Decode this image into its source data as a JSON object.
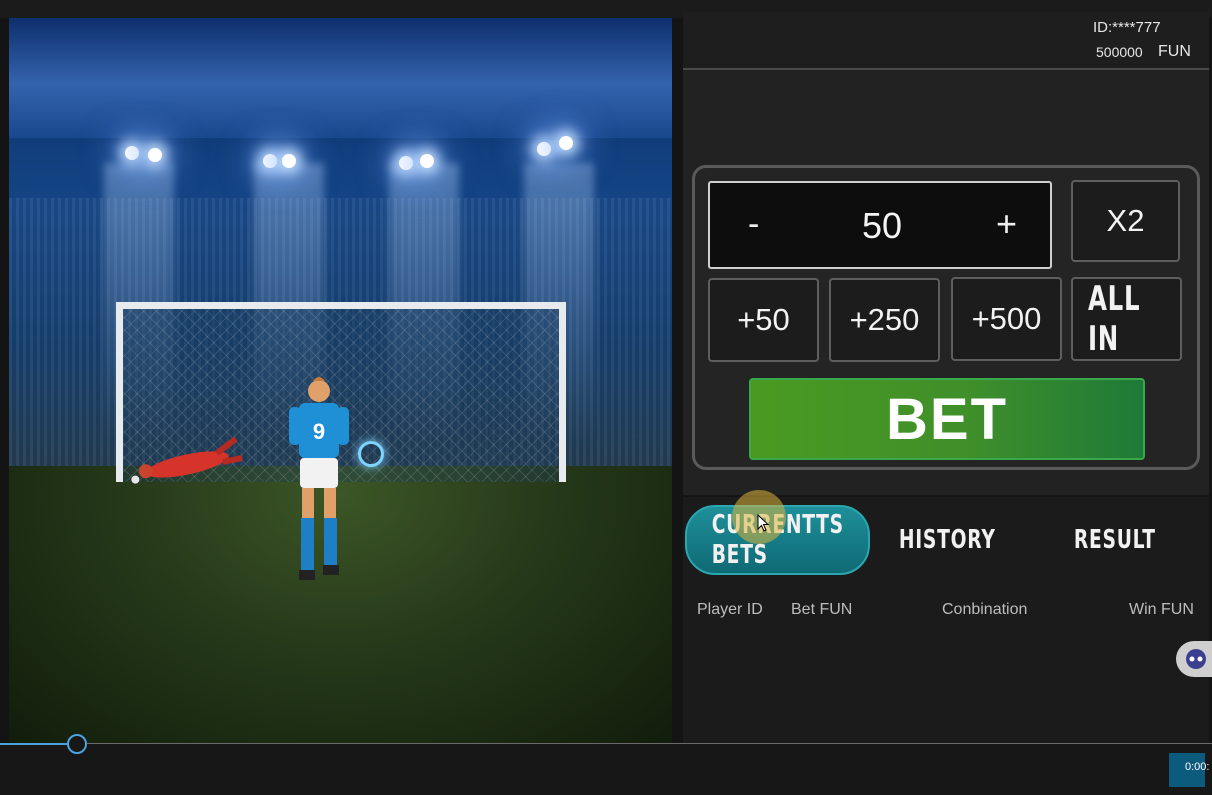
{
  "account": {
    "id": "ID:****777",
    "balance": "500000",
    "currency": "FUN"
  },
  "bet": {
    "minus": "-",
    "amount": "50",
    "plus": "+",
    "double": "X2",
    "quick": [
      "+50",
      "+250",
      "+500"
    ],
    "all_in": "ALL IN",
    "bet_label": "BET"
  },
  "tabs": {
    "current": "CURRENTTS BETS",
    "history": "HISTORY",
    "result": "RESULT"
  },
  "table_headers": [
    "Player ID",
    "Bet FUN",
    "Conbination",
    "Win FUN"
  ],
  "video": {
    "time": "0:00:"
  },
  "game": {
    "player_number": "9"
  },
  "colors": {
    "bet_green": "#3f8f2a",
    "tab_teal": "#1e8f9a",
    "progress_blue": "#4aa3df"
  }
}
